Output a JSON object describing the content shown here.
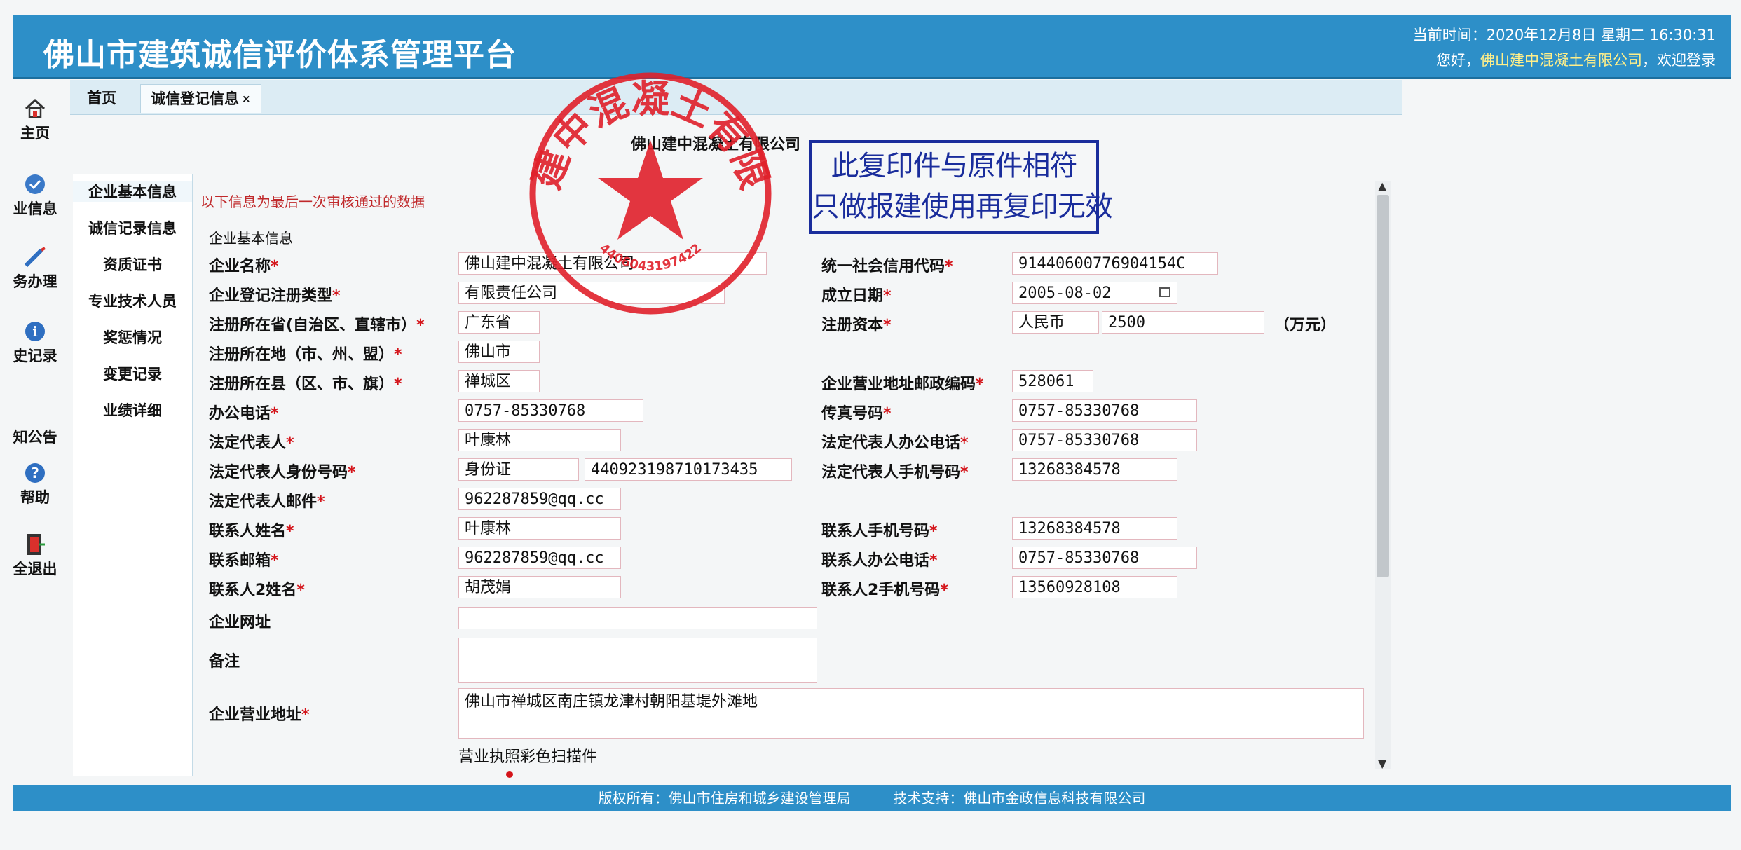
{
  "header": {
    "title": "佛山市建筑诚信评价体系管理平台",
    "time_label": "当前时间：",
    "time_value": "2020年12月8日 星期二 16:30:31",
    "greeting_prefix": "您好，",
    "company": "佛山建中混凝土有限公司",
    "greeting_suffix": "，欢迎登录"
  },
  "left_nav": [
    {
      "label": "主页",
      "icon": "home-icon"
    },
    {
      "label": "业信息",
      "icon": "company-info-icon"
    },
    {
      "label": "务办理",
      "icon": "business-icon"
    },
    {
      "label": "史记录",
      "icon": "history-icon"
    },
    {
      "label": "知公告",
      "icon": "notice-icon"
    },
    {
      "label": "帮助",
      "icon": "help-icon"
    },
    {
      "label": "全退出",
      "icon": "logout-icon"
    }
  ],
  "tabs": [
    {
      "label": "首页"
    },
    {
      "label": "诚信登记信息",
      "close": "×"
    }
  ],
  "page_heading": "佛山建中混凝土有限公司",
  "menu": [
    {
      "label": "企业基本信息"
    },
    {
      "label": "诚信记录信息"
    },
    {
      "label": "资质证书"
    },
    {
      "label": "专业技术人员"
    },
    {
      "label": "奖惩情况"
    },
    {
      "label": "变更记录"
    },
    {
      "label": "业绩详细"
    }
  ],
  "form": {
    "notice": "以下信息为最后一次审核通过的数据",
    "section_title": "企业基本信息",
    "required_mark": "*",
    "company_name": {
      "label": "企业名称",
      "value": "佛山建中混凝土有限公司"
    },
    "credit_code": {
      "label": "统一社会信用代码",
      "value": "91440600776904154C"
    },
    "reg_type": {
      "label": "企业登记注册类型",
      "value": "有限责任公司"
    },
    "found_date": {
      "label": "成立日期",
      "value": "2005-08-02"
    },
    "province": {
      "label": "注册所在省(自治区、直辖市）",
      "value": "广东省"
    },
    "capital": {
      "label": "注册资本",
      "currency": "人民币",
      "value": "2500",
      "unit": "（万元）"
    },
    "city": {
      "label": "注册所在地（市、州、盟）",
      "value": "佛山市"
    },
    "county": {
      "label": "注册所在县（区、市、旗）",
      "value": "禅城区"
    },
    "postcode": {
      "label": "企业营业地址邮政编码",
      "value": "528061"
    },
    "office_phone": {
      "label": "办公电话",
      "value": "0757-85330768"
    },
    "fax": {
      "label": "传真号码",
      "value": "0757-85330768"
    },
    "legal_rep": {
      "label": "法定代表人",
      "value": "叶康林"
    },
    "legal_office_phone": {
      "label": "法定代表人办公电话",
      "value": "0757-85330768"
    },
    "legal_id": {
      "label": "法定代表人身份号码",
      "type": "身份证",
      "value": "440923198710173435"
    },
    "legal_mobile": {
      "label": "法定代表人手机号码",
      "value": "13268384578"
    },
    "legal_email": {
      "label": "法定代表人邮件",
      "value": "962287859@qq.cc"
    },
    "contact_name": {
      "label": "联系人姓名",
      "value": "叶康林"
    },
    "contact_mobile": {
      "label": "联系人手机号码",
      "value": "13268384578"
    },
    "contact_email": {
      "label": "联系邮箱",
      "value": "962287859@qq.cc"
    },
    "contact_office_phone": {
      "label": "联系人办公电话",
      "value": "0757-85330768"
    },
    "contact2_name": {
      "label": "联系人2姓名",
      "value": "胡茂娟"
    },
    "contact2_mobile": {
      "label": "联系人2手机号码",
      "value": "13560928108"
    },
    "website": {
      "label": "企业网址",
      "value": ""
    },
    "remark": {
      "label": "备注",
      "value": ""
    },
    "address": {
      "label": "企业营业地址",
      "value": "佛山市禅城区南庄镇龙津村朝阳基堤外滩地"
    },
    "license_scan": {
      "label": "营业执照彩色扫描件"
    }
  },
  "footer": {
    "copyright": "版权所有：佛山市住房和城乡建设管理局",
    "support": "技术支持：佛山市金政信息科技有限公司"
  },
  "seal": {
    "ring_text": "佛山建中混凝土有限公司",
    "number": "4406043197422",
    "color": "#e0202a"
  },
  "copy_stamp": {
    "line1": "此复印件与原件相符",
    "line2": "只做报建使用再复印无效",
    "color": "#1a2d9c"
  }
}
